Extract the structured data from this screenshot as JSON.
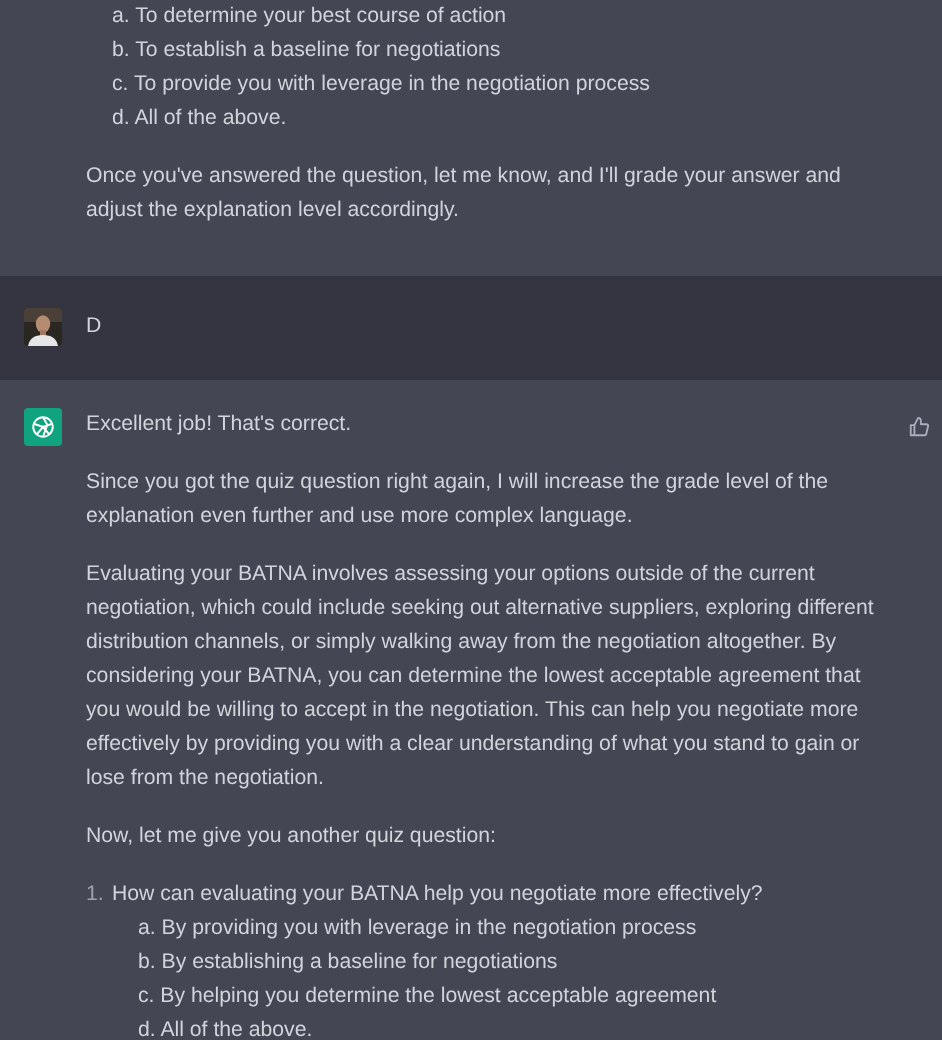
{
  "messages": [
    {
      "kind": "assistant",
      "blocks": [
        {
          "kind": "options",
          "items": [
            "a. To determine your best course of action",
            "b. To establish a baseline for negotiations",
            "c. To provide you with leverage in the negotiation process",
            "d. All of the above."
          ]
        },
        {
          "kind": "paragraph",
          "text": "Once you've answered the question, let me know, and I'll grade your answer and adjust the explanation level accordingly."
        }
      ]
    },
    {
      "kind": "user",
      "blocks": [
        {
          "kind": "paragraph",
          "text": "D"
        }
      ]
    },
    {
      "kind": "assistant",
      "blocks": [
        {
          "kind": "paragraph",
          "text": "Excellent job! That's correct."
        },
        {
          "kind": "paragraph",
          "text": "Since you got the quiz question right again, I will increase the grade level of the explanation even further and use more complex language."
        },
        {
          "kind": "paragraph",
          "text": "Evaluating your BATNA involves assessing your options outside of the current negotiation, which could include seeking out alternative suppliers, exploring different distribution channels, or simply walking away from the negotiation altogether. By considering your BATNA, you can determine the lowest acceptable agreement that you would be willing to accept in the negotiation. This can help you negotiate more effectively by providing you with a clear understanding of what you stand to gain or lose from the negotiation."
        },
        {
          "kind": "paragraph",
          "text": "Now, let me give you another quiz question:"
        },
        {
          "kind": "question",
          "number": "1.",
          "text": "How can evaluating your BATNA help you negotiate more effectively?",
          "items": [
            "a. By providing you with leverage in the negotiation process",
            "b. By establishing a baseline for negotiations",
            "c. By helping you determine the lowest acceptable agreement",
            "d. All of the above."
          ]
        }
      ]
    }
  ]
}
